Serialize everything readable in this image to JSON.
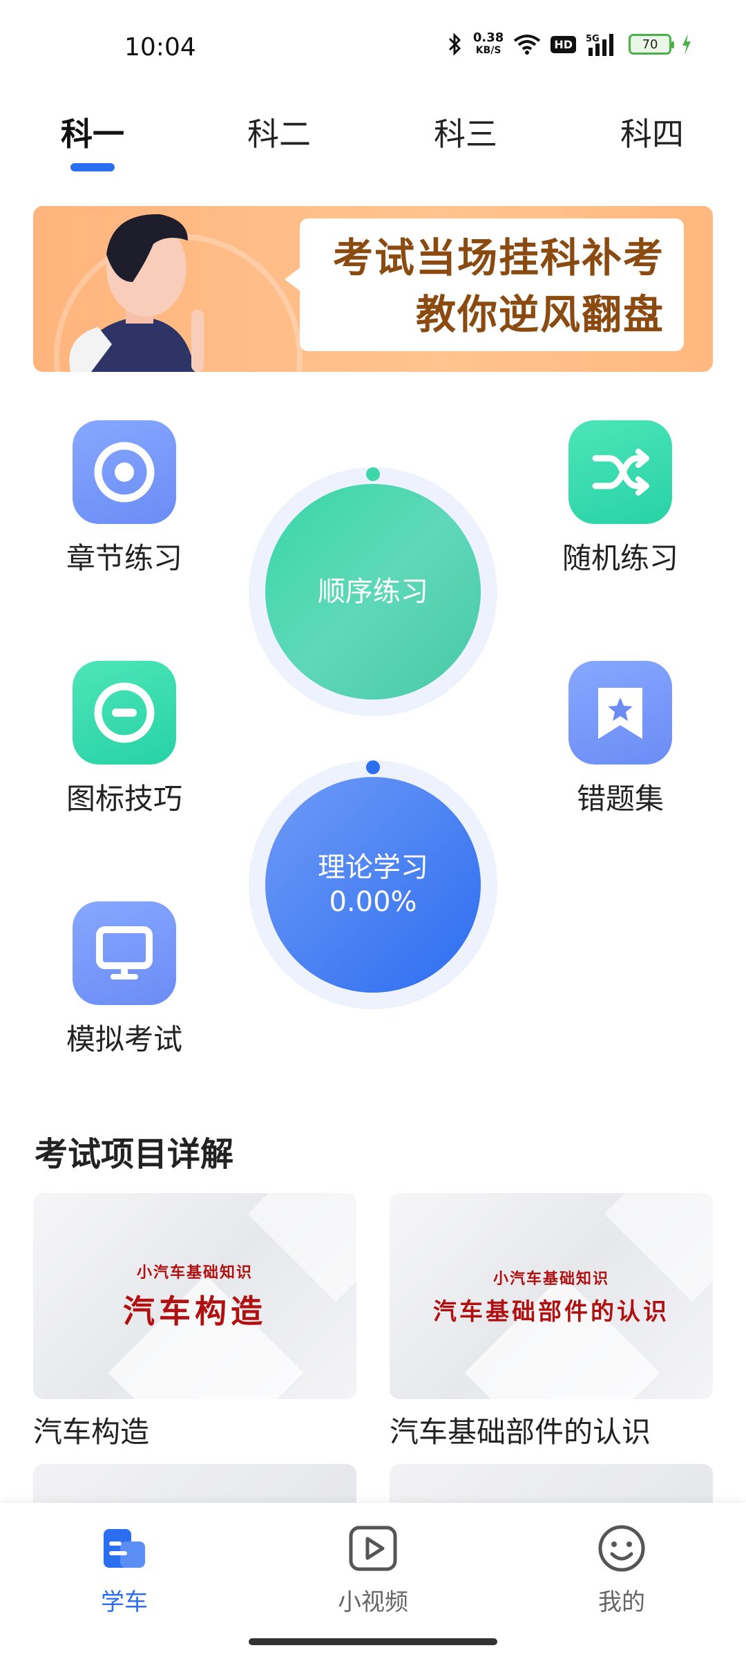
{
  "status_bar": {
    "time": "10:04",
    "net_speed_value": "0.38",
    "net_speed_unit": "KB/S",
    "hd": "HD",
    "network": "5G",
    "battery": "70"
  },
  "top_tabs": [
    {
      "label": "科一",
      "active": true
    },
    {
      "label": "科二",
      "active": false
    },
    {
      "label": "科三",
      "active": false
    },
    {
      "label": "科四",
      "active": false
    }
  ],
  "banner": {
    "line1": "考试当场挂科补考",
    "line2": "教你逆风翻盘"
  },
  "features": {
    "chapter": {
      "label": "章节练习",
      "icon": "target-icon"
    },
    "random": {
      "label": "随机练习",
      "icon": "shuffle-icon"
    },
    "signs": {
      "label": "图标技巧",
      "icon": "minus-circle-icon"
    },
    "mistakes": {
      "label": "错题集",
      "icon": "star-bookmark-icon"
    },
    "mock": {
      "label": "模拟考试",
      "icon": "monitor-icon"
    }
  },
  "circles": {
    "sequential": {
      "label": "顺序练习"
    },
    "theory": {
      "label": "理论学习",
      "progress": "0.00%"
    }
  },
  "section": {
    "title": "考试项目详解",
    "cards": [
      {
        "thumb_small": "小汽车基础知识",
        "thumb_big": "汽车构造",
        "title": "汽车构造"
      },
      {
        "thumb_small": "小汽车基础知识",
        "thumb_big": "汽车基础部件的认识",
        "title": "汽车基础部件的认识"
      }
    ]
  },
  "bottom_nav": [
    {
      "label": "学车",
      "icon": "car-study-icon",
      "active": true
    },
    {
      "label": "小视频",
      "icon": "video-play-icon",
      "active": false
    },
    {
      "label": "我的",
      "icon": "smiley-icon",
      "active": false
    }
  ],
  "colors": {
    "accent": "#2b6ff0",
    "green": "#3fd6aa",
    "banner_bg": "#ffb47d",
    "banner_text": "#8a4a10",
    "thumb_text": "#b01010"
  }
}
